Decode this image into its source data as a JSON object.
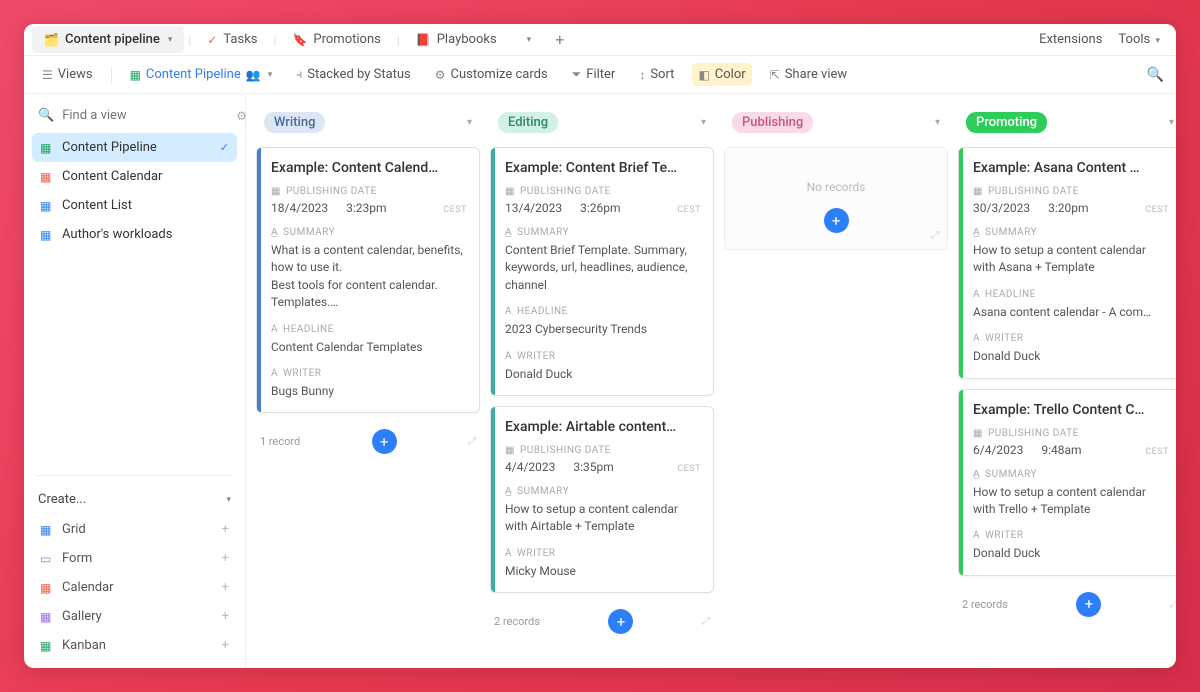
{
  "topnav": {
    "workspace_emoji": "🗂️",
    "workspace_name": "Content pipeline",
    "tabs": [
      {
        "icon": "✓",
        "label": "Tasks",
        "color": "#f06a4a"
      },
      {
        "icon": "🔖",
        "label": "Promotions",
        "color": "#e8a34a"
      },
      {
        "icon": "📕",
        "label": "Playbooks",
        "color": "#d64a5a"
      }
    ],
    "extensions": "Extensions",
    "tools": "Tools"
  },
  "toolbar": {
    "views": "Views",
    "current_view": "Content Pipeline",
    "stacked": "Stacked by Status",
    "customize": "Customize cards",
    "filter": "Filter",
    "sort": "Sort",
    "color": "Color",
    "share": "Share view"
  },
  "sidebar": {
    "find_placeholder": "Find a view",
    "views": [
      {
        "icon": "▦",
        "label": "Content Pipeline",
        "active": true,
        "iconClass": "green"
      },
      {
        "icon": "▦",
        "label": "Content Calendar",
        "iconClass": "red"
      },
      {
        "icon": "▦",
        "label": "Content List",
        "iconClass": "blue"
      },
      {
        "icon": "▦",
        "label": "Author's workloads",
        "iconClass": "blue"
      }
    ],
    "create_label": "Create...",
    "create_options": [
      {
        "icon": "▦",
        "label": "Grid",
        "iconClass": "blue"
      },
      {
        "icon": "▭",
        "label": "Form",
        "iconClass": "purple"
      },
      {
        "icon": "▦",
        "label": "Calendar",
        "iconClass": "red"
      },
      {
        "icon": "▦",
        "label": "Gallery",
        "iconClass": "purple"
      },
      {
        "icon": "▦",
        "label": "Kanban",
        "iconClass": "green"
      }
    ]
  },
  "labels": {
    "publishing_date": "PUBLISHING DATE",
    "summary": "SUMMARY",
    "headline": "HEADLINE",
    "writer": "WRITER",
    "no_records": "No records",
    "one_record": "1 record",
    "two_records": "2 records"
  },
  "board": {
    "columns": [
      {
        "name": "Writing",
        "pillClass": "writing",
        "footer": "one_record",
        "cards": [
          {
            "color": "c-blue",
            "title": "Example: Content Calend…",
            "date": "18/4/2023",
            "time": "3:23pm",
            "tz": "CEST",
            "summary": "What is a content calendar, benefits, how to use it.\nBest tools for content calendar. Templates.…",
            "headline": "Content Calendar Templates",
            "writer": "Bugs Bunny"
          }
        ]
      },
      {
        "name": "Editing",
        "pillClass": "editing",
        "footer": "two_records",
        "cards": [
          {
            "color": "c-teal",
            "title": "Example: Content Brief Te…",
            "date": "13/4/2023",
            "time": "3:26pm",
            "tz": "CEST",
            "summary": "Content Brief Template. Summary, keywords, url, headlines, audience, channel",
            "headline": "2023 Cybersecurity Trends",
            "writer": "Donald Duck"
          },
          {
            "color": "c-teal",
            "title": "Example: Airtable content…",
            "date": "4/4/2023",
            "time": "3:35pm",
            "tz": "CEST",
            "summary": "How to setup a content calendar with Airtable + Template",
            "writer": "Micky Mouse"
          }
        ]
      },
      {
        "name": "Publishing",
        "pillClass": "publishing",
        "empty": true
      },
      {
        "name": "Promoting",
        "pillClass": "promoting",
        "footer": "two_records",
        "cards": [
          {
            "color": "c-green",
            "title": "Example: Asana Content …",
            "date": "30/3/2023",
            "time": "3:20pm",
            "tz": "CEST",
            "summary": "How to setup a content calendar with Asana + Template",
            "headline": "Asana content calendar - A com…",
            "writer": "Donald Duck"
          },
          {
            "color": "c-green",
            "title": "Example: Trello Content C…",
            "date": "6/4/2023",
            "time": "9:48am",
            "tz": "CEST",
            "summary": "How to setup a content calendar with Trello + Template",
            "writer": "Donald Duck"
          }
        ]
      }
    ]
  }
}
